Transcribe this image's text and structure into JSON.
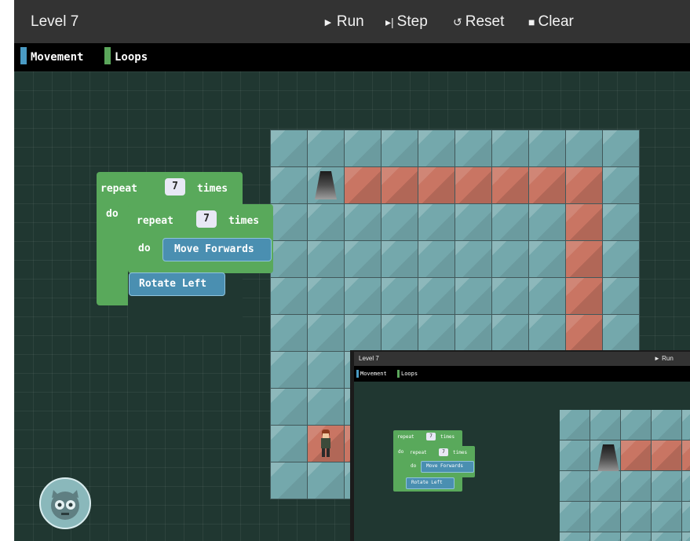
{
  "header": {
    "level_title": "Level 7",
    "run_label": "Run",
    "step_label": "Step",
    "reset_label": "Reset",
    "clear_label": "Clear"
  },
  "categories": [
    {
      "label": "Movement",
      "color": "#4a9bc4"
    },
    {
      "label": "Loops",
      "color": "#5ba65b"
    }
  ],
  "blocks": {
    "outer_repeat": {
      "repeat_label": "repeat",
      "count": "7",
      "times_label": "times",
      "do_label": "do"
    },
    "inner_repeat": {
      "repeat_label": "repeat",
      "count": "7",
      "times_label": "times",
      "do_label": "do"
    },
    "move_forwards": "Move Forwards",
    "rotate_left": "Rotate Left"
  },
  "maze": {
    "columns": 10,
    "rows": 10,
    "exit_cell": [
      1,
      1
    ],
    "character_cell": [
      8,
      1
    ],
    "path_cells": [
      [
        1,
        2
      ],
      [
        1,
        3
      ],
      [
        1,
        4
      ],
      [
        1,
        5
      ],
      [
        1,
        6
      ],
      [
        1,
        7
      ],
      [
        1,
        8
      ],
      [
        2,
        8
      ],
      [
        3,
        8
      ],
      [
        4,
        8
      ],
      [
        5,
        8
      ],
      [
        6,
        8
      ],
      [
        8,
        2
      ]
    ]
  },
  "thumbnail": {
    "level_title": "Level 7",
    "run_label": "Run",
    "categories": [
      "Movement",
      "Loops"
    ],
    "outer_count": "7",
    "inner_count": "7",
    "repeat_label": "repeat",
    "times_label": "times",
    "do_label": "do",
    "move_forwards": "Move Forwards",
    "rotate_left": "Rotate Left"
  },
  "icons": {
    "run": "play-icon",
    "step": "step-icon",
    "reset": "reset-icon",
    "clear": "trash-icon",
    "robot": "robot-avatar-icon"
  },
  "colors": {
    "topbar": "#333333",
    "category_bar": "#000000",
    "workspace": "#203731",
    "loop_block": "#59a95b",
    "movement_block": "#4a8fb1",
    "floor_tile": "#74a8ac",
    "path_tile": "#c97563"
  }
}
